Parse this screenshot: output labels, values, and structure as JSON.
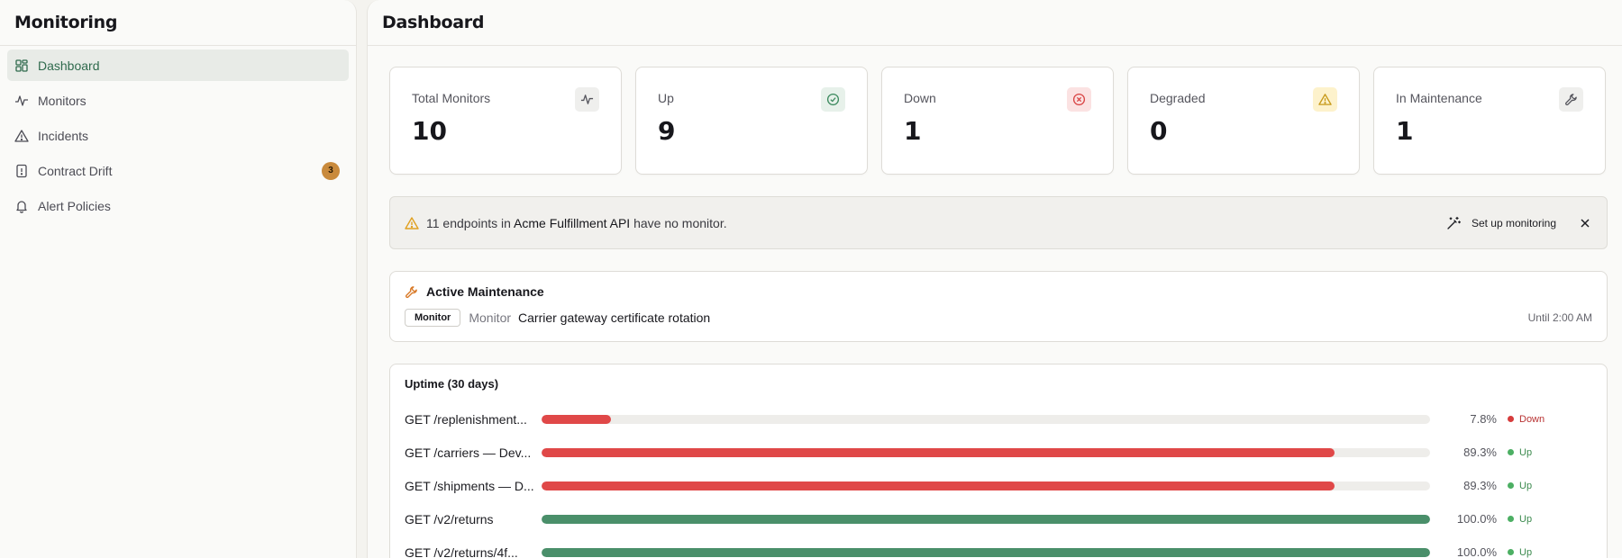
{
  "sidebar": {
    "brand": "Monitoring",
    "items": [
      {
        "label": "Dashboard",
        "icon": "dashboard-grid-icon",
        "active": true
      },
      {
        "label": "Monitors",
        "icon": "activity-icon"
      },
      {
        "label": "Incidents",
        "icon": "warning-triangle-icon"
      },
      {
        "label": "Contract Drift",
        "icon": "file-alert-icon",
        "badge": "3"
      },
      {
        "label": "Alert Policies",
        "icon": "bell-icon"
      }
    ]
  },
  "header": {
    "title": "Dashboard"
  },
  "cards": [
    {
      "label": "Total Monitors",
      "value": "10",
      "icon": "activity-icon",
      "color": "#55555d",
      "bg": "#efefed"
    },
    {
      "label": "Up",
      "value": "9",
      "icon": "check-circle-icon",
      "color": "#3c8a5e",
      "bg": "#e7f1ea"
    },
    {
      "label": "Down",
      "value": "1",
      "icon": "x-circle-icon",
      "color": "#d94444",
      "bg": "#fbe2e2"
    },
    {
      "label": "Degraded",
      "value": "0",
      "icon": "warning-triangle-icon",
      "color": "#c79a1a",
      "bg": "#fdf2cc"
    },
    {
      "label": "In Maintenance",
      "value": "1",
      "icon": "wrench-icon",
      "color": "#55555d",
      "bg": "#efefed"
    }
  ],
  "alert": {
    "count_text": "11 endpoints in ",
    "api_name": "Acme Fulfillment API",
    "suffix": " have no monitor.",
    "action": "Set up monitoring"
  },
  "maintenance": {
    "title": "Active Maintenance",
    "tag": "Monitor",
    "kind": "Monitor",
    "name": "Carrier gateway certificate rotation",
    "until": "Until 2:00 AM"
  },
  "uptime": {
    "title": "Uptime (30 days)",
    "rows": [
      {
        "name": "GET /replenishment...",
        "percent": 7.8,
        "label": "7.8%",
        "status": "Down",
        "bar_color": "#e04848",
        "status_color": "#d63c3c",
        "text_color": "#b83232"
      },
      {
        "name": "GET /carriers — Dev...",
        "percent": 89.3,
        "label": "89.3%",
        "status": "Up",
        "bar_color": "#e04848",
        "status_color": "#4caf63",
        "text_color": "#3c8a4e"
      },
      {
        "name": "GET /shipments — D...",
        "percent": 89.3,
        "label": "89.3%",
        "status": "Up",
        "bar_color": "#e04848",
        "status_color": "#4caf63",
        "text_color": "#3c8a4e"
      },
      {
        "name": "GET /v2/returns",
        "percent": 100.0,
        "label": "100.0%",
        "status": "Up",
        "bar_color": "#4a8f6a",
        "status_color": "#4caf63",
        "text_color": "#3c8a4e"
      },
      {
        "name": "GET /v2/returns/4f...",
        "percent": 100.0,
        "label": "100.0%",
        "status": "Up",
        "bar_color": "#4a8f6a",
        "status_color": "#4caf63",
        "text_color": "#3c8a4e"
      }
    ]
  },
  "colors": {
    "accent": "#2f6a4d",
    "badge": "#c98a3c",
    "warn": "#e0a020",
    "wrench": "#d97b2a"
  }
}
